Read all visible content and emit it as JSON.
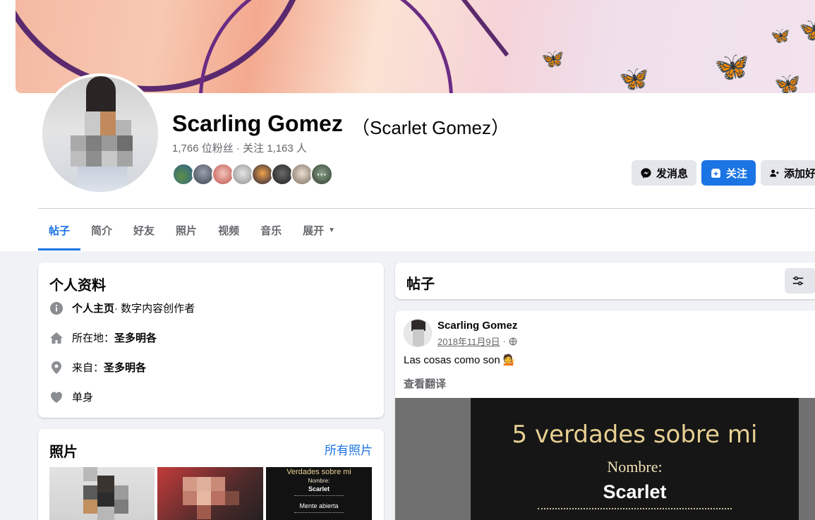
{
  "profile": {
    "name": "Scarling Gomez",
    "alternate_name": "（Scarlet Gomez）",
    "stats": "1,766 位粉丝 · 关注 1,163 人"
  },
  "actions": {
    "message": "发消息",
    "follow": "关注",
    "add_friend": "添加好"
  },
  "tabs": [
    "帖子",
    "简介",
    "好友",
    "照片",
    "视频",
    "音乐",
    "展开"
  ],
  "intro": {
    "title": "个人资料",
    "page_type_label": "个人主页",
    "page_type_value": " · 数字内容创作者",
    "location_label": "所在地：",
    "location_value": "圣多明各",
    "from_label": "来自：",
    "from_value": "圣多明各",
    "relationship": "单身"
  },
  "photos": {
    "title": "照片",
    "see_all": "所有照片",
    "thumb3_lines": [
      "Verdades sobre mi",
      "Nombre:",
      "Scarlet",
      "Mente abierta"
    ]
  },
  "posts_header": {
    "title": "帖子"
  },
  "post": {
    "author": "Scarling Gomez",
    "date": "2018年11月9日",
    "date_sep": "·",
    "text": "Las cosas como son 💁",
    "see_translation": "查看翻译",
    "image": {
      "title": "5 verdades sobre mi",
      "nombre": "Nombre:",
      "name": "Scarlet"
    }
  },
  "colors": {
    "accent": "#1b74e4",
    "background": "#f0f2f5",
    "secondary_text": "#65676b"
  }
}
